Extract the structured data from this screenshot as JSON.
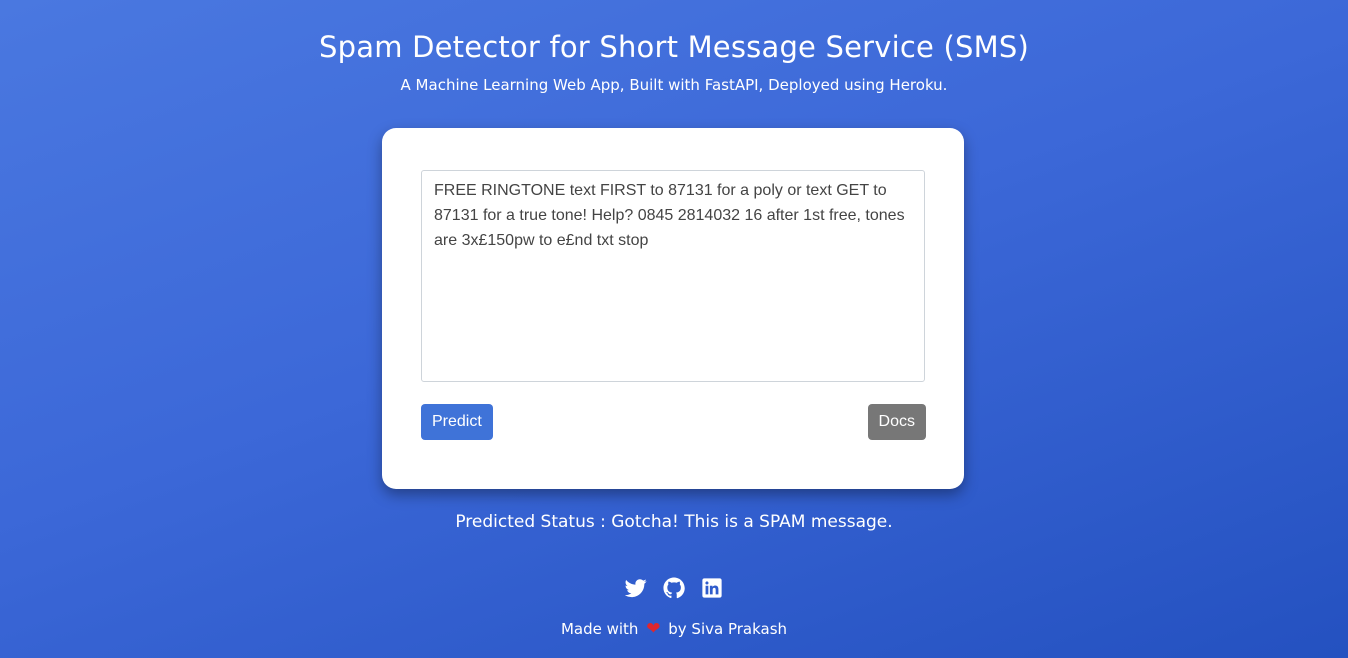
{
  "header": {
    "title": "Spam Detector for Short Message Service (SMS)",
    "subtitle": "A Machine Learning Web App, Built with FastAPI, Deployed using Heroku."
  },
  "form": {
    "message_value": "FREE RINGTONE text FIRST to 87131 for a poly or text GET to 87131 for a true tone! Help? 0845 2814032 16 after 1st free, tones are 3x£150pw to e£nd txt stop",
    "predict_label": "Predict",
    "docs_label": "Docs"
  },
  "result": {
    "status_text": "Predicted Status : Gotcha! This is a SPAM message."
  },
  "social": {
    "icons": [
      "twitter-icon",
      "github-icon",
      "linkedin-icon"
    ]
  },
  "footer": {
    "made_with": "Made with",
    "by": "by Siva Prakash"
  },
  "colors": {
    "background": "#3c68d8",
    "predict_button": "#3f73d8",
    "docs_button": "#777777",
    "heart": "#e0262d"
  }
}
